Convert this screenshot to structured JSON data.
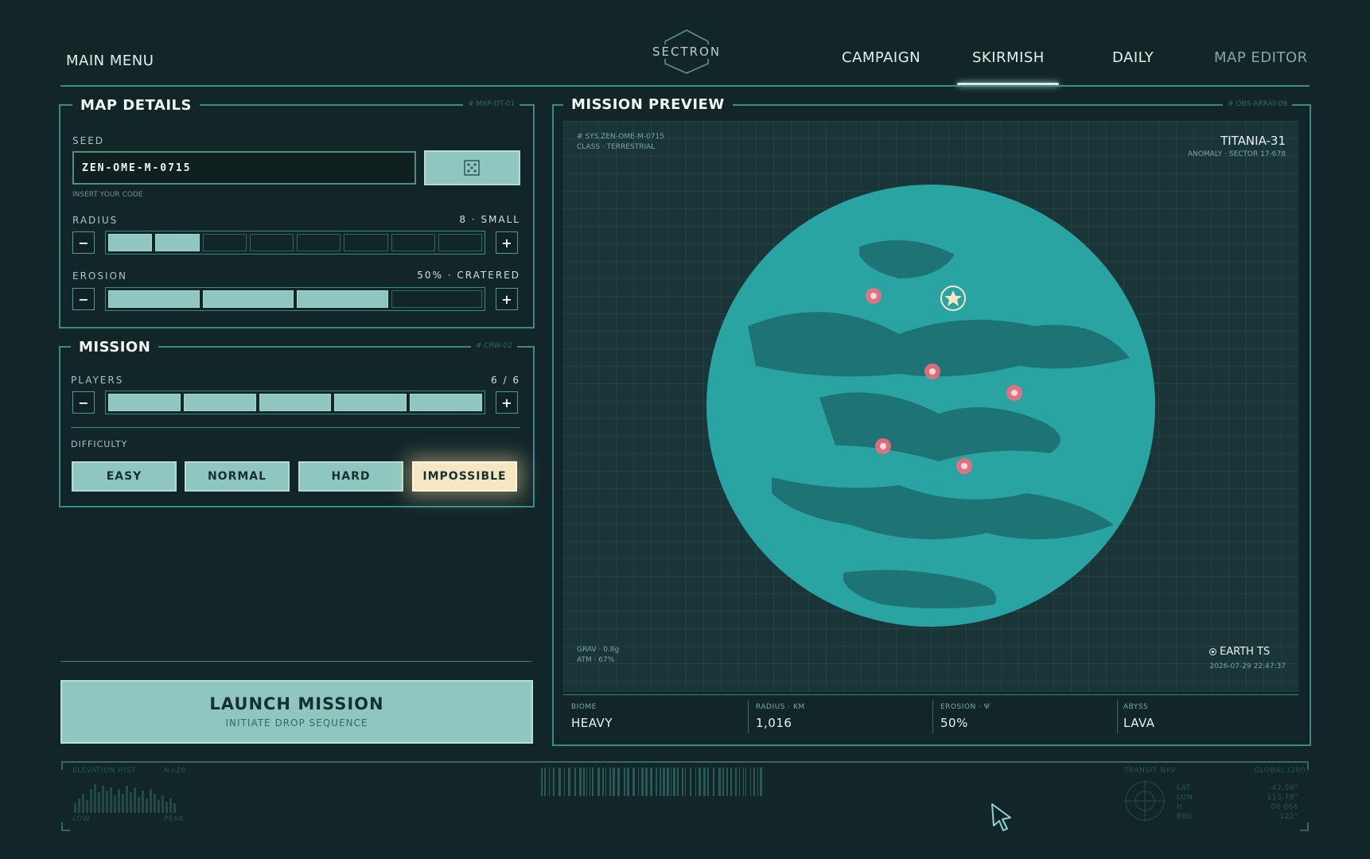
{
  "nav": {
    "main_menu": "MAIN MENU",
    "logo": "SECTRON",
    "tabs": [
      "CAMPAIGN",
      "SKIRMISH",
      "DAILY",
      "MAP EDITOR"
    ],
    "active_tab": "SKIRMISH"
  },
  "map_details": {
    "title": "MAP DETAILS",
    "tag": "# MAP-DT-01",
    "seed_label": "SEED",
    "seed_value": "ZEN-OME-M-0715",
    "seed_hint": "INSERT YOUR CODE",
    "randomize_icon": "dice-icon",
    "radius_label": "RADIUS",
    "radius_value": "8 · SMALL",
    "radius_fill": {
      "filled": 2,
      "total": 8
    },
    "erosion_label": "EROSION",
    "erosion_value": "50% · CRATERED",
    "erosion_fill": {
      "filled": 3,
      "total": 4
    }
  },
  "mission": {
    "title": "MISSION",
    "tag": "# CRW-02",
    "players_label": "PLAYERS",
    "players_value": "6 / 6",
    "players_fill": {
      "filled": 5,
      "total": 5
    },
    "difficulty_label": "DIFFICULTY",
    "difficulties": [
      "EASY",
      "NORMAL",
      "HARD",
      "IMPOSSIBLE"
    ],
    "selected_difficulty": "IMPOSSIBLE"
  },
  "launch": {
    "title": "LAUNCH MISSION",
    "subtitle": "INITIATE DROP SEQUENCE"
  },
  "preview": {
    "title": "MISSION PREVIEW",
    "tag": "# OBS-ARRAY-09",
    "sys_line1": "# SYS.ZEN-OME-M-0715",
    "sys_line2": "CLASS · TERRESTRIAL",
    "planet_name": "TITANIA-31",
    "planet_sub": "ANOMALY · SECTOR 17-678",
    "grav": "GRAV · 0.8g",
    "atm": "ATM · 67%",
    "earth_label": "EARTH TS",
    "timestamp": "2026-07-29 22:47:37",
    "stats": [
      {
        "label": "BIOME",
        "value": "HEAVY"
      },
      {
        "label": "RADIUS · KM",
        "value": "1,016"
      },
      {
        "label": "EROSION · Ψ",
        "value": "50%"
      },
      {
        "label": "ABYSS",
        "value": "LAVA"
      }
    ]
  },
  "hud": {
    "elevation_label": "ELEVATION HIST",
    "elevation_count": "N=26",
    "elevation_low": "LOW",
    "elevation_peak": "PEAK",
    "transit_label": "TRANSIT NAV",
    "transit_global": "GLOBAL (200)",
    "transit_keys": [
      "LAT",
      "LON",
      "H",
      "BRG"
    ],
    "transit_vals": [
      "-42.58°",
      "113.78°",
      "08 066",
      "122°"
    ]
  },
  "colors": {
    "background": "#122628",
    "accent": "#3d8a86",
    "segment_on": "#8fc7c0",
    "planet": "#2aa3a3",
    "marker": "#ff6b7a",
    "highlight": "#f6e7c4"
  }
}
